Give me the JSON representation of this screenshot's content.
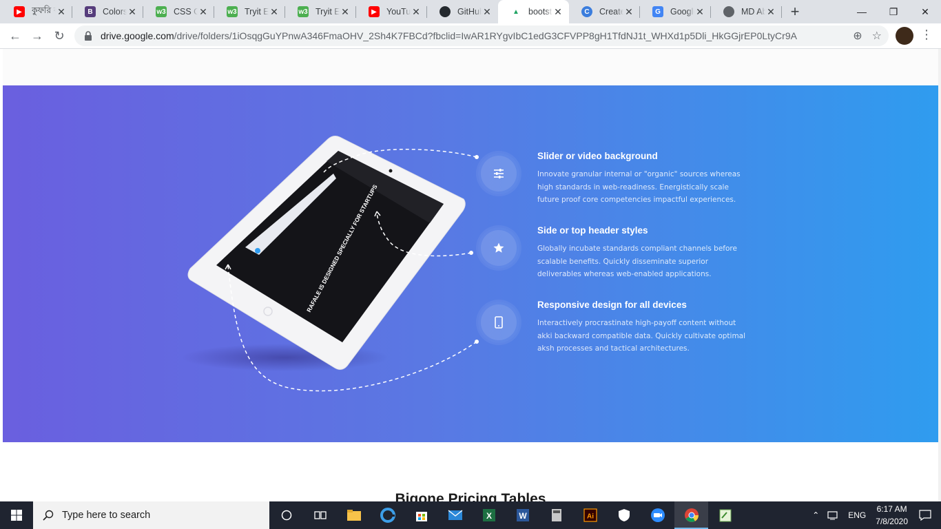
{
  "tabs": [
    {
      "title": "কুফরি ক",
      "favicon": "youtube-icon",
      "color": "#ff0000"
    },
    {
      "title": "Colors ·",
      "favicon": "bootstrap-icon",
      "color": "#563d7c"
    },
    {
      "title": "CSS Gra",
      "favicon": "w3schools-icon",
      "color": "#4caf50"
    },
    {
      "title": "Tryit Ed",
      "favicon": "w3schools-icon",
      "color": "#4caf50"
    },
    {
      "title": "Tryit Ed",
      "favicon": "w3schools-icon",
      "color": "#4caf50"
    },
    {
      "title": "YouTub",
      "favicon": "youtube-icon",
      "color": "#ff0000"
    },
    {
      "title": "GitHub",
      "favicon": "github-icon",
      "color": "#24292e"
    },
    {
      "title": "bootstr",
      "favicon": "google-drive-icon",
      "color": "#1fa463",
      "active": true
    },
    {
      "title": "Create",
      "favicon": "canva-icon",
      "color": "#3b7ddd"
    },
    {
      "title": "Google",
      "favicon": "google-search-icon",
      "color": "#4285f4"
    },
    {
      "title": "MD Ab",
      "favicon": "globe-icon",
      "color": "#5f6368"
    }
  ],
  "address_bar": {
    "host": "drive.google.com",
    "path": "/drive/folders/1iOsqgGuYPnwA346FmaOHV_2Sh4K7FBCd?fbclid=IwAR1RYgvIbC1edG3CFVPP8gH1TfdNJ1t_WHXd1p5Dli_HkGGjrEP0LtyCr9A"
  },
  "features": [
    {
      "title": "Slider or video background",
      "text": "Innovate granular internal or \"organic\" sources whereas high standards in web-readiness. Energistically scale future proof core competencies impactful experiences.",
      "icon": "sliders-icon"
    },
    {
      "title": "Side or top header styles",
      "text": "Globally incubate standards compliant channels before scalable benefits. Quickly disseminate superior deliverables whereas web-enabled applications.",
      "icon": "star-icon"
    },
    {
      "title": "Responsive design for all devices",
      "text": "Interactively procrastinate high-payoff content without akki backward compatible data. Quickly cultivate optimal aksh processes and tactical architectures.",
      "icon": "mobile-icon"
    }
  ],
  "tablet_screen": {
    "headline": "RAFALE IS DESIGNED SPECIALLY FOR STARTUPS",
    "brand": "Rafale"
  },
  "pricing_title": "Bigone Pricing Tables",
  "taskbar": {
    "search_placeholder": "Type here to search",
    "language": "ENG",
    "time": "6:17 AM",
    "date": "7/8/2020"
  },
  "colors": {
    "gradient_start": "#6a5fdf",
    "gradient_end": "#2f9cef"
  }
}
